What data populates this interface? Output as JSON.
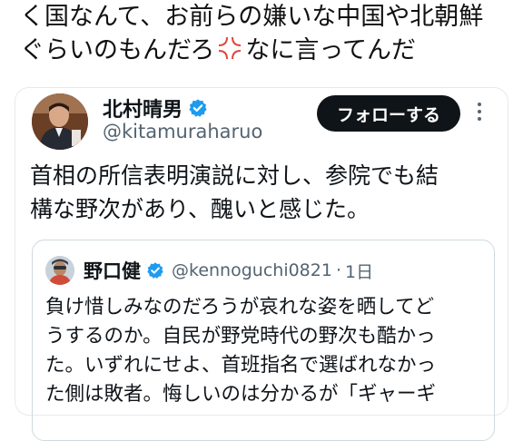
{
  "header_text": {
    "line1": "く国なんて、お前らの嫌いな中国や北朝鮮",
    "line2_before": "ぐらいのもんだろ",
    "line2_after": "なに言ってんだ"
  },
  "tweet": {
    "author_name": "北村晴男",
    "author_handle": "@kitamuraharuo",
    "follow_label": "フォローする",
    "text_line1": "首相の所信表明演説に対し、参院でも結",
    "text_line2": "構な野次があり、醜いと感じた。"
  },
  "quoted_tweet": {
    "author_name": "野口健",
    "author_handle": "@kennoguchi0821",
    "separator": "·",
    "time": "1日",
    "text_line1": "負け惜しみなのだろうが哀れな姿を晒してど",
    "text_line2": "うするのか。自民が野党時代の野次も酷かっ",
    "text_line3": "た。いずれにせよ、首班指名で選ばれなかっ",
    "text_line4": "た側は敗者。悔しいのは分かるが「ギャーギ"
  },
  "colors": {
    "verified": "#1d9bf0",
    "follow_button": "#0f1419",
    "secondary_text": "#536471",
    "anger_emoji": "#e0463c"
  },
  "icons": {
    "anger": "anger-symbol-icon",
    "verified": "verified-badge-icon",
    "more": "more-dots-icon"
  }
}
